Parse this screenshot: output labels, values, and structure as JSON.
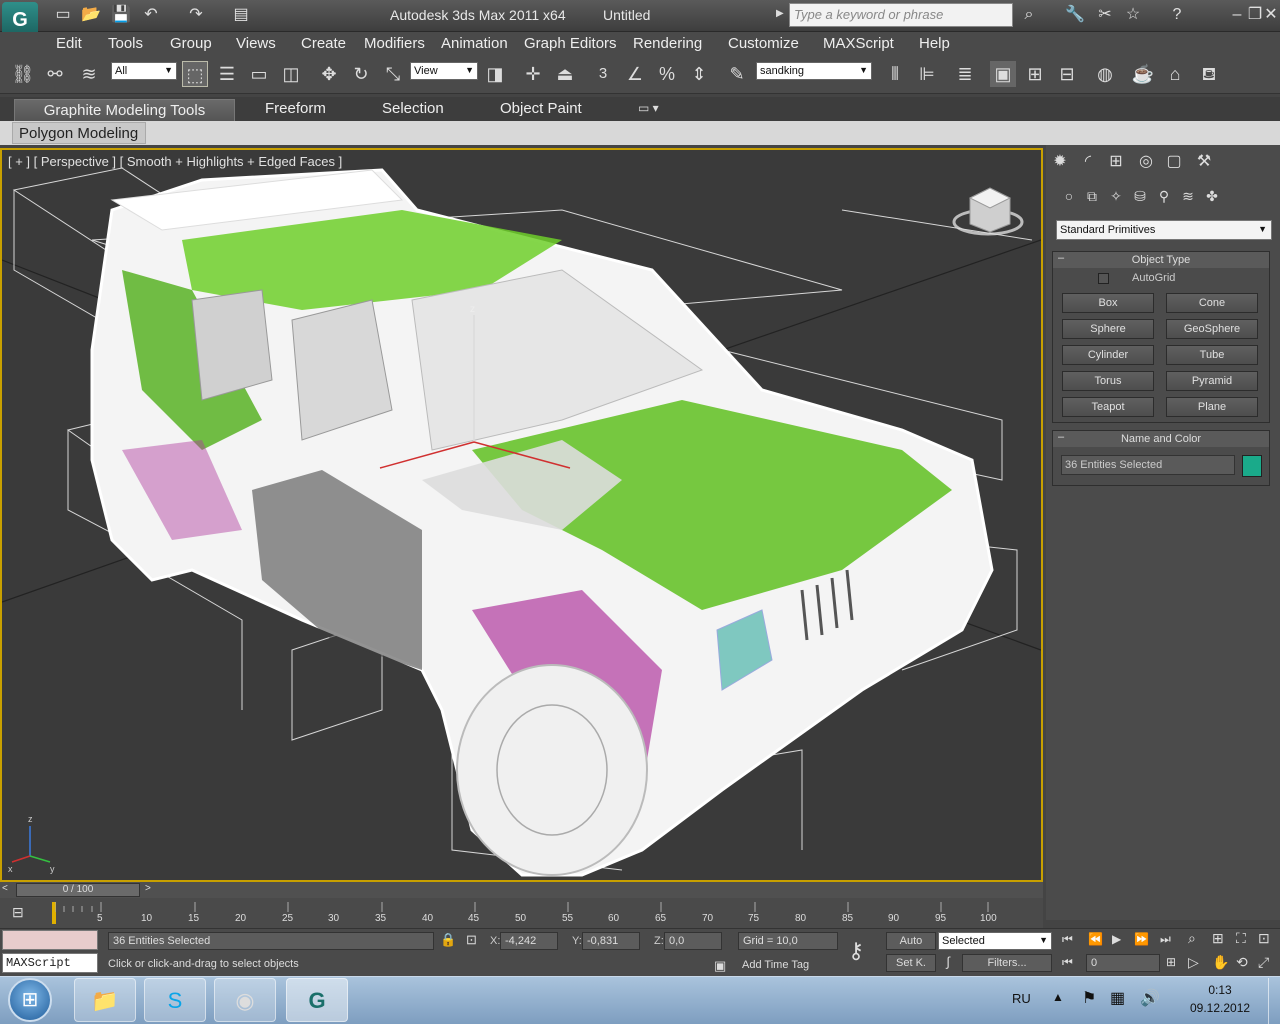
{
  "titlebar": {
    "app_title": "Autodesk 3ds Max  2011 x64",
    "doc_title": "Untitled",
    "search_placeholder": "Type a keyword or phrase",
    "app_logo": "3ds-max-logo"
  },
  "menu": [
    "Edit",
    "Tools",
    "Group",
    "Views",
    "Create",
    "Modifiers",
    "Animation",
    "Graph Editors",
    "Rendering",
    "Customize",
    "MAXScript",
    "Help"
  ],
  "toolbar": {
    "selection_filter": "All",
    "ref_coord": "View",
    "named_selection": "sandking",
    "snap_label": "3"
  },
  "ribbon": {
    "tabs": [
      "Graphite Modeling Tools",
      "Freeform",
      "Selection",
      "Object Paint"
    ],
    "subtab": "Polygon Modeling"
  },
  "viewport": {
    "label": "[ + ] [ Perspective ] [ Smooth + Highlights + Edged Faces ]",
    "axis_z": "z",
    "axis_x": "x",
    "axis_y": "y"
  },
  "command_panel": {
    "category": "Standard Primitives",
    "object_type_title": "Object Type",
    "autogrid": "AutoGrid",
    "primitives": [
      "Box",
      "Cone",
      "Sphere",
      "GeoSphere",
      "Cylinder",
      "Tube",
      "Torus",
      "Pyramid",
      "Teapot",
      "Plane"
    ],
    "name_color_title": "Name and Color",
    "name_value": "36 Entities Selected",
    "swatch_color": "#1aaa8a"
  },
  "timeline": {
    "thumb": "0 / 100",
    "ticks": [
      "5",
      "10",
      "15",
      "20",
      "25",
      "30",
      "35",
      "40",
      "45",
      "50",
      "55",
      "60",
      "65",
      "70",
      "75",
      "80",
      "85",
      "90",
      "95",
      "100"
    ]
  },
  "status": {
    "maxscript": "MAXScript",
    "selection_count": "36 Entities Selected",
    "prompt": "Click or click-and-drag to select objects",
    "x_label": "X:",
    "x_value": "-4,242",
    "y_label": "Y:",
    "y_value": "-0,831",
    "z_label": "Z:",
    "z_value": "0,0",
    "grid": "Grid = 10,0",
    "add_time_tag": "Add Time Tag",
    "auto_key": "Auto",
    "set_key": "Set K.",
    "key_filter_mode": "Selected",
    "filters": "Filters...",
    "frame": "0"
  },
  "taskbar": {
    "lang": "RU",
    "time": "0:13",
    "date": "09.12.2012"
  }
}
